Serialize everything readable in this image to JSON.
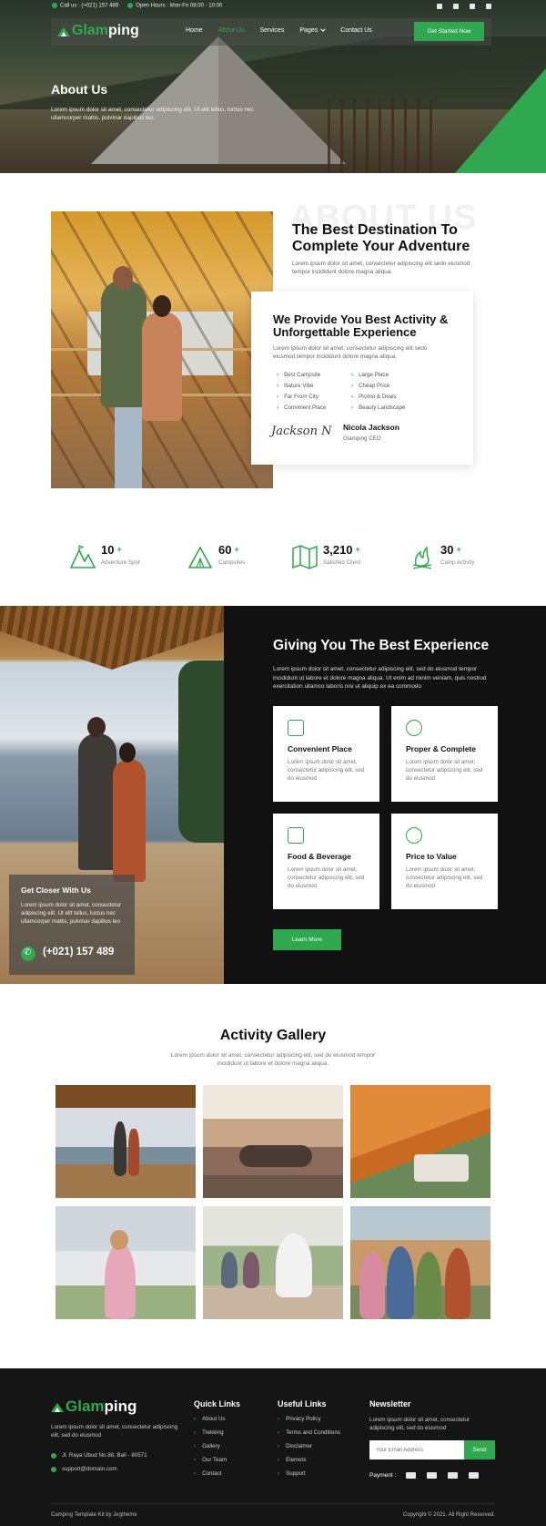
{
  "topbar": {
    "call": "Call us : (+021) 157 489",
    "hours": "Open Hours : Mon-Fri 08:00 - 10:00",
    "social_icons": [
      "facebook-icon",
      "twitter-icon",
      "youtube-icon",
      "instagram-icon"
    ]
  },
  "nav": {
    "logo_prefix": "Glam",
    "logo_suffix": "ping",
    "items": [
      "Home",
      "About Us",
      "Services",
      "Pages",
      "Contact Us"
    ],
    "active_index": 1,
    "cta": "Get Started Now"
  },
  "hero": {
    "title": "About Us",
    "text": "Lorem ipsum dolor sit amet, consectetur adipiscing elit. Ut elit tellus, luctus nec ullamcorper mattis, pulvinar dapibus leo."
  },
  "about": {
    "watermark": "ABOUT US",
    "title": "The Best Destination To Complete Your Adventure",
    "text": "Lorem ipsum dolor sit amet, consectetur adipiscing elit sedo eiusmod tempor incididunt dolore magna aliqua.",
    "card": {
      "title": "We Provide You Best Activity & Unforgettable Experience",
      "text": "Lorem ipsum dolor sit amet, consectetur adipiscing elit sedo eiusmod tempor incididunt dolore magna aliqua.",
      "features": [
        "Best Campsite",
        "Large Place",
        "Nature Vibe",
        "Cheap Price",
        "Far From City",
        "Promo & Deals",
        "Convinient Place",
        "Beauty Landscape"
      ],
      "signature": "Jackson N",
      "name": "Nicola Jackson",
      "role": "Glamping CEO"
    }
  },
  "stats": [
    {
      "icon": "mountain-icon",
      "value": "10",
      "label": "Adventure Spot"
    },
    {
      "icon": "tent-icon",
      "value": "60",
      "label": "Campsites"
    },
    {
      "icon": "map-icon",
      "value": "3,210",
      "label": "Satisfied Client"
    },
    {
      "icon": "campfire-icon",
      "value": "30",
      "label": "Camp Activity"
    }
  ],
  "experience": {
    "title": "Giving You The Best Experience",
    "text": "Lorem ipsum dolor sit amet, consectetur adipiscing elit, sed do eiusmod tempor incididunt ut labore et dolore magna aliqua. Ut enim ad minim veniam, quis nostrud exercitation ullamco laboris nisi ut aliquip ex ea commodo",
    "features": [
      {
        "icon": "cabin-icon",
        "title": "Convenient Place",
        "text": "Lorem ipsum dolor sit amet, consectetur adipiscing elit, sed do eiusmod"
      },
      {
        "icon": "badge-icon",
        "title": "Proper & Complete",
        "text": "Lorem ipsum dolor sit amet, consectetur adipiscing elit, sed do eiusmod"
      },
      {
        "icon": "food-icon",
        "title": "Food & Beverage",
        "text": "Lorem ipsum dolor sit amet, consectetur adipiscing elit, sed do eiusmod"
      },
      {
        "icon": "money-bag-icon",
        "title": "Price to Value",
        "text": "Lorem ipsum dolor sit amet, consectetur adipiscing elit, sed do eiusmod"
      }
    ],
    "cta": "Learn More",
    "closer": {
      "title": "Get Closer With Us",
      "text": "Lorem ipsum dolor sit amet, consectetur adipiscing elit. Ut elit tellus, luctus nec ullamcorper mattis, pulvinar dapibus leo",
      "phone": "(+021) 157 489"
    }
  },
  "gallery": {
    "title": "Activity Gallery",
    "text": "Lorem ipsum dolor sit amet, consectetur adipiscing elit, sed do eiusmod tempor incididunt ut labore et dolore magna aliqua."
  },
  "footer": {
    "logo_prefix": "Glam",
    "logo_suffix": "ping",
    "text": "Lorem ipsum dolor sit amet, consectetur adipiscing elit, sed do eiusmod",
    "address": "Jl. Raya Ubud No.88, Bali - 80571",
    "email": "support@domain.com",
    "quick_links_title": "Quick Links",
    "quick_links": [
      "About Us",
      "Trekking",
      "Gallery",
      "Our Team",
      "Contact"
    ],
    "useful_links_title": "Useful Links",
    "useful_links": [
      "Privacy Policy",
      "Terms and Conditions",
      "Disclaimer",
      "Elemets",
      "Support"
    ],
    "newsletter_title": "Newsletter",
    "newsletter_text": "Lorem ipsum dolor sit amet, consectetur adipiscing elit, sed do eiusmod",
    "email_placeholder": "Your Email Address",
    "send": "Send",
    "payment_label": "Payment :",
    "payment_icons": [
      "visa-icon",
      "mastercard-icon",
      "paypal-icon",
      "amex-icon"
    ],
    "copyright_left": "Camping Template Kit by Jegtheme",
    "copyright_right": "Copyright © 2021. All Right Reserved."
  },
  "colors": {
    "accent": "#2fa84f",
    "dark": "#111111"
  }
}
